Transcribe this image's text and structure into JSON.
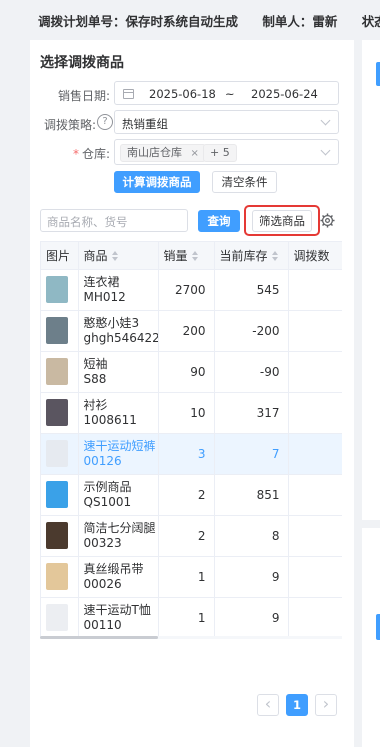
{
  "header": {
    "plan_no": "调拨计划单号：保存时系统自动生成",
    "creator": "制单人：雷新",
    "status": "状态："
  },
  "panel": {
    "title": "选择调拨商品",
    "sale_date_label": "销售日期:",
    "date_start": "2025-06-18",
    "date_sep": "~",
    "date_end": "2025-06-24",
    "strategy_label": "调拨策略:",
    "strategy_value": "热销重组",
    "warehouse_label": "仓库:",
    "warehouse_tag": "南山店仓库",
    "warehouse_more": "+ 5",
    "calc_button": "计算调拨商品",
    "clear_button": "清空条件",
    "search_placeholder": "商品名称、货号",
    "query_button": "查询",
    "filter_button": "筛选商品"
  },
  "table": {
    "columns": [
      "图片",
      "商品",
      "销量",
      "当前库存",
      "调拨数"
    ],
    "rows": [
      {
        "name": "连衣裙",
        "code": "MH012",
        "sales": "2700",
        "stock": "545",
        "thumb": "#8fb8c4",
        "negative": false,
        "selected": false
      },
      {
        "name": "憨憨小娃3",
        "code": "ghgh546422",
        "sales": "200",
        "stock": "-200",
        "thumb": "#6d7f8a",
        "negative": true,
        "selected": false
      },
      {
        "name": "短袖",
        "code": "S88",
        "sales": "90",
        "stock": "-90",
        "thumb": "#c9b9a2",
        "negative": true,
        "selected": false
      },
      {
        "name": "衬衫",
        "code": "1008611",
        "sales": "10",
        "stock": "317",
        "thumb": "#5a5560",
        "negative": false,
        "selected": false
      },
      {
        "name": "速干运动短裤",
        "code": "00126",
        "sales": "3",
        "stock": "7",
        "thumb": "#e6eaf0",
        "negative": false,
        "selected": true
      },
      {
        "name": "示例商品",
        "code": "QS1001",
        "sales": "2",
        "stock": "851",
        "thumb": "#3aa1e8",
        "negative": false,
        "selected": false
      },
      {
        "name": "简洁七分阔腿",
        "code": "00323",
        "sales": "2",
        "stock": "8",
        "thumb": "#4b3a2e",
        "negative": false,
        "selected": false
      },
      {
        "name": "真丝缎吊带",
        "code": "00026",
        "sales": "1",
        "stock": "9",
        "thumb": "#e3c79a",
        "negative": false,
        "selected": false
      },
      {
        "name": "速干运动T恤",
        "code": "00110",
        "sales": "1",
        "stock": "9",
        "thumb": "#eceef2",
        "negative": false,
        "selected": false
      }
    ]
  },
  "pagination": {
    "prev": "‹",
    "current": "1",
    "next": "›"
  },
  "icons": {
    "date": "calendar-icon",
    "help": "help-circle-icon",
    "settings": "gear-icon",
    "sort": "sort-caret-icon"
  },
  "colors": {
    "primary": "#409eff",
    "danger": "#f56c6c",
    "highlight_border": "#e53935"
  }
}
